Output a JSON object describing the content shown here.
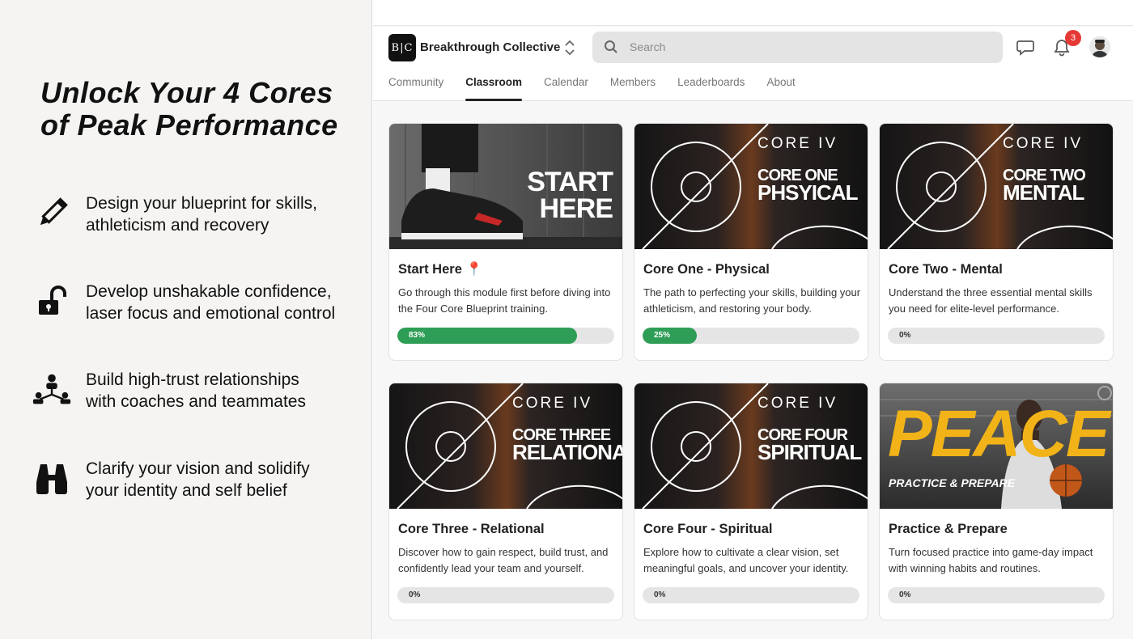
{
  "promo": {
    "headline": "Unlock Your 4 Cores of Peak Performance",
    "features": [
      {
        "icon": "pencil-icon",
        "text_line1": "Design your blueprint for skills,",
        "text_line2": "athleticism and recovery"
      },
      {
        "icon": "unlocked-padlock-icon",
        "text_line1": "Develop unshakable confidence,",
        "text_line2": "laser focus and emotional control"
      },
      {
        "icon": "people-network-icon",
        "text_line1": "Build high-trust relationships",
        "text_line2": "with coaches and teammates"
      },
      {
        "icon": "binoculars-icon",
        "text_line1": "Clarify your vision and solidify",
        "text_line2": "your identity and self belief"
      }
    ]
  },
  "app": {
    "logo_text": "B|C",
    "community_name": "Breakthrough Collective",
    "search_placeholder": "Search",
    "notification_count": "3",
    "tabs": [
      {
        "label": "Community",
        "active": false
      },
      {
        "label": "Classroom",
        "active": true
      },
      {
        "label": "Calendar",
        "active": false
      },
      {
        "label": "Members",
        "active": false
      },
      {
        "label": "Leaderboards",
        "active": false
      },
      {
        "label": "About",
        "active": false
      }
    ],
    "colors": {
      "progress": "#2e9d55",
      "badge": "#e53935",
      "core_bg": "#161616"
    }
  },
  "courses": [
    {
      "title": "Start Here 📍",
      "description": "Go through this module first before diving into the Four Core Blueprint training.",
      "progress": 83,
      "progress_label": "83%",
      "thumb_line1": "START",
      "thumb_line2": "HERE"
    },
    {
      "title": "Core One - Physical",
      "description": "The path to perfecting your skills, building your athleticism, and restoring your body.",
      "progress": 25,
      "progress_label": "25%",
      "thumb_brand": "CORE IV",
      "thumb_line1": "CORE ONE",
      "thumb_line2": "PHSYICAL"
    },
    {
      "title": "Core Two - Mental",
      "description": "Understand the three essential mental skills you need for elite-level performance.",
      "progress": 0,
      "progress_label": "0%",
      "thumb_brand": "CORE IV",
      "thumb_line1": "CORE TWO",
      "thumb_line2": "MENTAL"
    },
    {
      "title": "Core Three - Relational",
      "description": "Discover how to gain respect, build trust, and confidently lead your team and yourself.",
      "progress": 0,
      "progress_label": "0%",
      "thumb_brand": "CORE IV",
      "thumb_line1": "CORE THREE",
      "thumb_line2": "RELATIONAL"
    },
    {
      "title": "Core Four - Spiritual",
      "description": "Explore how to cultivate a clear vision, set meaningful goals, and uncover your identity.",
      "progress": 0,
      "progress_label": "0%",
      "thumb_brand": "CORE IV",
      "thumb_line1": "CORE FOUR",
      "thumb_line2": "SPIRITUAL"
    },
    {
      "title": "Practice & Prepare",
      "description": "Turn focused practice into game-day impact with winning habits and routines.",
      "progress": 0,
      "progress_label": "0%",
      "thumb_big": "PEACE",
      "thumb_line1": "PRACTICE & PREPARE"
    }
  ]
}
